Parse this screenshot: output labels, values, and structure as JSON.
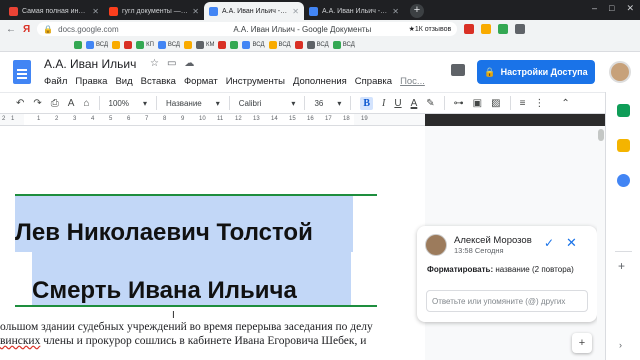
{
  "browser": {
    "tabs": [
      {
        "title": "Самая полная инструкция...",
        "favicon_color": "#ea4335"
      },
      {
        "title": "гугл документы — Яндекс...",
        "favicon_color": "#fc3f1d"
      },
      {
        "title": "А.А. Иван Ильич - Goog...",
        "favicon_color": "#4285f4",
        "active": true
      },
      {
        "title": "А.А. Иван Ильич - Google...",
        "favicon_color": "#4285f4"
      }
    ],
    "new_tab_label": "+",
    "window_controls": [
      "–",
      "□",
      "✕"
    ],
    "back_label": "←",
    "yandex_label": "Я",
    "url": "docs.google.com",
    "page_title_center": "А.А. Иван Ильич - Google Документы",
    "reviews_label": "★1К отзывов",
    "bookmarks": [
      "ВСД",
      "КП",
      "ВСД",
      "КМ",
      "ВСД",
      "ВСД",
      "ВСД",
      "ВСД"
    ]
  },
  "docs": {
    "title": "А.А. Иван Ильич",
    "menu": [
      "Файл",
      "Правка",
      "Вид",
      "Вставка",
      "Формат",
      "Инструменты",
      "Дополнения",
      "Справка",
      "Пос..."
    ],
    "share_label": "Настройки Доступа",
    "toolbar": {
      "zoom": "100%",
      "style": "Название",
      "font": "Calibri",
      "size": "36",
      "bold": "B",
      "italic": "I",
      "underline": "U",
      "text_color": "A"
    },
    "ruler_numbers": [
      "2",
      "1",
      "1",
      "2",
      "3",
      "4",
      "5",
      "6",
      "7",
      "8",
      "9",
      "10",
      "11",
      "12",
      "13",
      "14",
      "15",
      "16",
      "17",
      "18",
      "19"
    ]
  },
  "document": {
    "heading1": "Лев Николаевич Толстой",
    "heading2": "Смерть Ивана Ильича",
    "body_line1": "ольшом здании судебных учреждений во время перерыва заседания по делу",
    "body_line2_a": "винских",
    "body_line2_b": " члены и прокурор сошлись в кабинете Ивана Егоровича Шебек, и",
    "cursor_glyph": "I"
  },
  "comment": {
    "author": "Алексей Морозов",
    "time": "13:58 Сегодня",
    "action_bold": "Форматировать:",
    "action_text": " название (2 повтора)",
    "reply_placeholder": "Ответьте или упомяните (@) других",
    "resolve_icon": "✓",
    "close_icon": "✕"
  },
  "side": {
    "add_comment_label": "+",
    "plus_label": "+",
    "expand_label": "›"
  },
  "colors": {
    "accent": "#1a73e8",
    "selection": "#c2d7f7",
    "selection_border": "#1e8e3e"
  }
}
